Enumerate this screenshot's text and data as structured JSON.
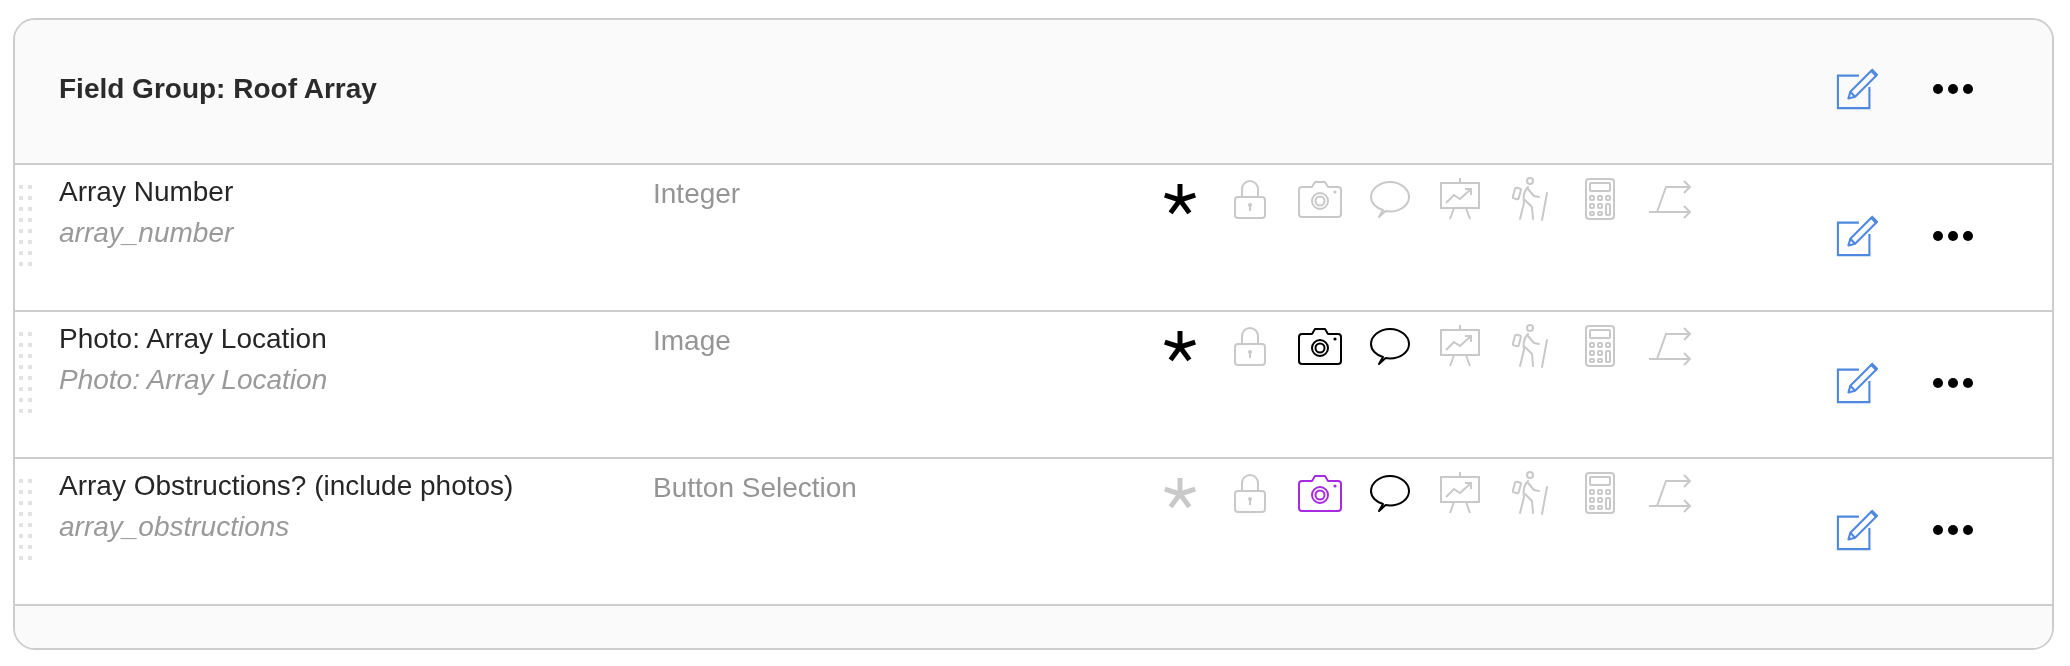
{
  "group": {
    "title": "Field Group: Roof Array"
  },
  "fields": [
    {
      "label": "Array Number",
      "subtitle": "array_number",
      "type": "Integer",
      "flags": [
        {
          "kind": "required",
          "on": true
        },
        {
          "kind": "locked",
          "on": false
        },
        {
          "kind": "photo",
          "on": false
        },
        {
          "kind": "comment",
          "on": false
        },
        {
          "kind": "report",
          "on": false
        },
        {
          "kind": "walk",
          "on": false
        },
        {
          "kind": "calculation",
          "on": false
        },
        {
          "kind": "branch",
          "on": false
        }
      ]
    },
    {
      "label": "Photo: Array Location",
      "subtitle": "Photo: Array Location",
      "type": "Image",
      "flags": [
        {
          "kind": "required",
          "on": true
        },
        {
          "kind": "locked",
          "on": false
        },
        {
          "kind": "photo",
          "on": true
        },
        {
          "kind": "comment",
          "on": true
        },
        {
          "kind": "report",
          "on": false
        },
        {
          "kind": "walk",
          "on": false
        },
        {
          "kind": "calculation",
          "on": false
        },
        {
          "kind": "branch",
          "on": false
        }
      ]
    },
    {
      "label": "Array Obstructions? (include photos)",
      "subtitle": "array_obstructions",
      "type": "Button Selection",
      "flags": [
        {
          "kind": "required",
          "on": false
        },
        {
          "kind": "locked",
          "on": false
        },
        {
          "kind": "photo",
          "on": true,
          "color": "#a62be0"
        },
        {
          "kind": "comment",
          "on": true
        },
        {
          "kind": "report",
          "on": false
        },
        {
          "kind": "walk",
          "on": false
        },
        {
          "kind": "calculation",
          "on": false
        },
        {
          "kind": "branch",
          "on": false
        }
      ]
    }
  ]
}
